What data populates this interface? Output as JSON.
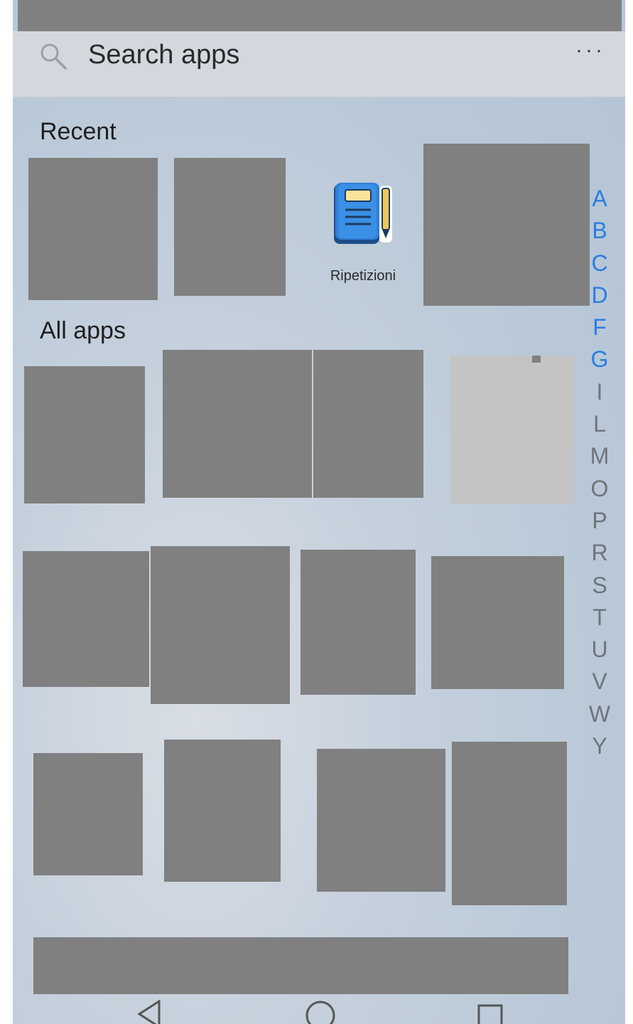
{
  "search": {
    "placeholder": "Search apps",
    "more_label": "···"
  },
  "sections": {
    "recent": "Recent",
    "all_apps": "All apps"
  },
  "recent_app": {
    "label": "Ripetizioni",
    "icon": "notebook-icon"
  },
  "alphabet_index": [
    {
      "letter": "A",
      "active": true
    },
    {
      "letter": "B",
      "active": true
    },
    {
      "letter": "C",
      "active": true
    },
    {
      "letter": "D",
      "active": true
    },
    {
      "letter": "F",
      "active": true
    },
    {
      "letter": "G",
      "active": true
    },
    {
      "letter": "I",
      "active": false
    },
    {
      "letter": "L",
      "active": false
    },
    {
      "letter": "M",
      "active": false
    },
    {
      "letter": "O",
      "active": false
    },
    {
      "letter": "P",
      "active": false
    },
    {
      "letter": "R",
      "active": false
    },
    {
      "letter": "S",
      "active": false
    },
    {
      "letter": "T",
      "active": false
    },
    {
      "letter": "U",
      "active": false
    },
    {
      "letter": "V",
      "active": false
    },
    {
      "letter": "W",
      "active": false
    },
    {
      "letter": "Y",
      "active": false
    }
  ],
  "colors": {
    "index_active": "#2a7de1",
    "index_inactive": "#6f747a",
    "redaction": "#808080"
  },
  "nav": {
    "back": "back-icon",
    "home": "home-icon",
    "recents": "recents-icon"
  }
}
